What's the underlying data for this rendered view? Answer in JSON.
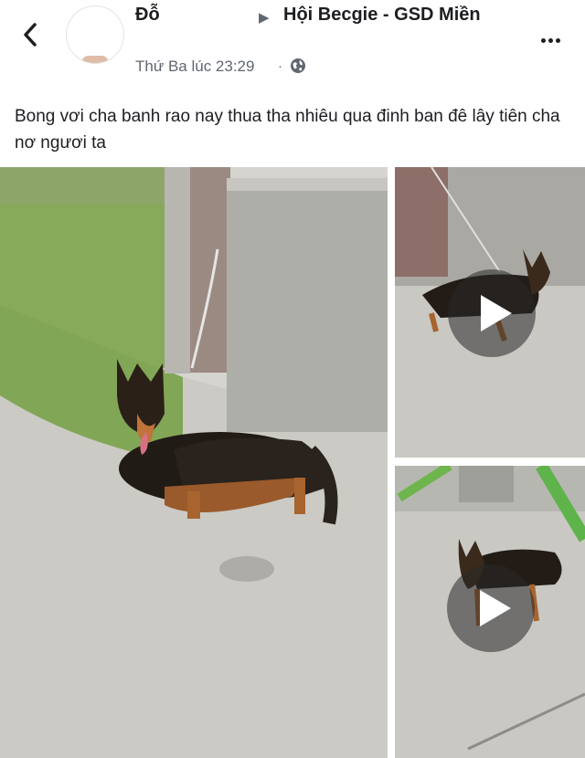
{
  "header": {
    "author_name": "Đỗ",
    "separator_icon": "triangle-right-icon",
    "group_name": "Hội Becgie - GSD Miền",
    "timestamp": "Thứ Ba lúc 23:29",
    "dot": "·",
    "audience_icon": "globe-icon",
    "back_icon": "chevron-left-icon",
    "more_icon": "more-horizontal-icon"
  },
  "post": {
    "text": "Bong vơi cha banh rao nay thua tha nhiêu qua đinh ban đê lây tiên cha nơ ngươi ta"
  },
  "media": [
    {
      "type": "photo",
      "content": "German shepherd standing on concrete by a wall"
    },
    {
      "type": "video",
      "content": "German shepherd on concrete yard",
      "play_icon": "play-icon"
    },
    {
      "type": "video",
      "content": "German shepherd near playground slide",
      "play_icon": "play-icon"
    }
  ],
  "colors": {
    "text": "#1c1e21",
    "secondary": "#606770"
  }
}
